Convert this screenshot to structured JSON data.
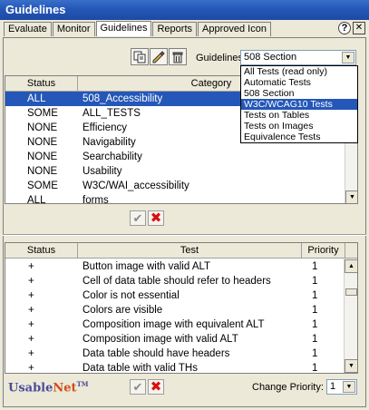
{
  "window": {
    "title": "Guidelines"
  },
  "tabs": [
    "Evaluate",
    "Monitor",
    "Guidelines",
    "Reports",
    "Approved Icon"
  ],
  "window_controls": {
    "help": "?",
    "close": "✕"
  },
  "toolbar": {
    "icons": [
      "copy-icon",
      "edit-icon",
      "delete-icon"
    ],
    "guidelines_label": "Guidelines:",
    "guidelines_value": "508 Section"
  },
  "dropdown": {
    "options": [
      "All Tests (read only)",
      "Automatic Tests",
      "508 Section",
      "W3C/WCAG10 Tests",
      "Tests on Tables",
      "Tests on Images",
      "Equivalence Tests"
    ],
    "highlighted": "W3C/WCAG10 Tests"
  },
  "upper_table": {
    "headers": [
      "Status",
      "Category"
    ],
    "rows": [
      {
        "status": "ALL",
        "category": "508_Accessibility",
        "selected": true
      },
      {
        "status": "SOME",
        "category": "ALL_TESTS"
      },
      {
        "status": "NONE",
        "category": "Efficiency"
      },
      {
        "status": "NONE",
        "category": "Navigability"
      },
      {
        "status": "NONE",
        "category": "Searchability"
      },
      {
        "status": "NONE",
        "category": "Usability"
      },
      {
        "status": "SOME",
        "category": "W3C/WAI_accessibility"
      },
      {
        "status": "ALL",
        "category": "forms"
      }
    ]
  },
  "upper_actions": {
    "apply": "✔",
    "cancel": "✖"
  },
  "lower_table": {
    "headers": [
      "Status",
      "Test",
      "Priority"
    ],
    "rows": [
      {
        "status": "+",
        "test": "Button image with valid ALT",
        "priority": "1"
      },
      {
        "status": "+",
        "test": "Cell of data table should refer to headers",
        "priority": "1"
      },
      {
        "status": "+",
        "test": "Color is not essential",
        "priority": "1"
      },
      {
        "status": "+",
        "test": "Colors are visible",
        "priority": "1"
      },
      {
        "status": "+",
        "test": "Composition image with equivalent ALT",
        "priority": "1"
      },
      {
        "status": "+",
        "test": "Composition image with valid ALT",
        "priority": "1"
      },
      {
        "status": "+",
        "test": "Data table should have headers",
        "priority": "1"
      },
      {
        "status": "+",
        "test": "Data table with valid THs",
        "priority": "1"
      }
    ]
  },
  "footer": {
    "logo_usable": "Usable",
    "logo_net": "Net",
    "logo_tm": "TM",
    "apply": "✔",
    "cancel": "✖",
    "change_priority_label": "Change Priority:",
    "priority_value": "1"
  },
  "colors": {
    "selection": "#2457b8",
    "titlebar": "#2457b8",
    "cancel": "#d81010"
  }
}
